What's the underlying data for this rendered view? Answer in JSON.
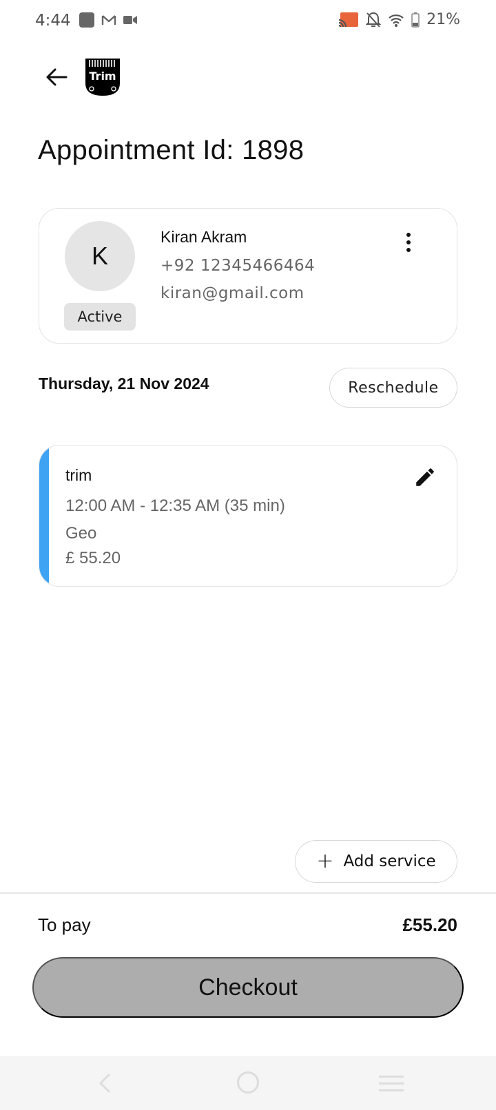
{
  "status_bar": {
    "time": "4:44",
    "left_icons": [
      "app-square-icon",
      "gmail-icon",
      "video-camera-icon"
    ],
    "right_icons": [
      "cast-icon",
      "notifications-off-icon",
      "wifi-icon",
      "battery-icon"
    ],
    "battery": "21%",
    "cast_color": "#e8643a"
  },
  "header": {
    "back_icon": "arrow-left-icon",
    "logo_text": "Trim"
  },
  "page": {
    "title": "Appointment Id: 1898"
  },
  "customer": {
    "initial": "K",
    "name": "Kiran Akram",
    "phone": "+92 12345466464",
    "email": "kiran@gmail.com",
    "status": "Active",
    "menu_icon": "more-vertical-icon"
  },
  "appointment": {
    "date": "Thursday, 21 Nov 2024",
    "reschedule_label": "Reschedule"
  },
  "services": [
    {
      "name": "trim",
      "time": "12:00 AM - 12:35 AM (35 min)",
      "staff": "Geo",
      "price": "£ 55.20",
      "accent_color": "#3fa3f4",
      "edit_icon": "pencil-icon"
    }
  ],
  "actions": {
    "add_service_label": "Add service",
    "add_icon": "plus-icon"
  },
  "footer": {
    "to_pay_label": "To pay",
    "to_pay_amount": "£55.20",
    "checkout_label": "Checkout"
  }
}
